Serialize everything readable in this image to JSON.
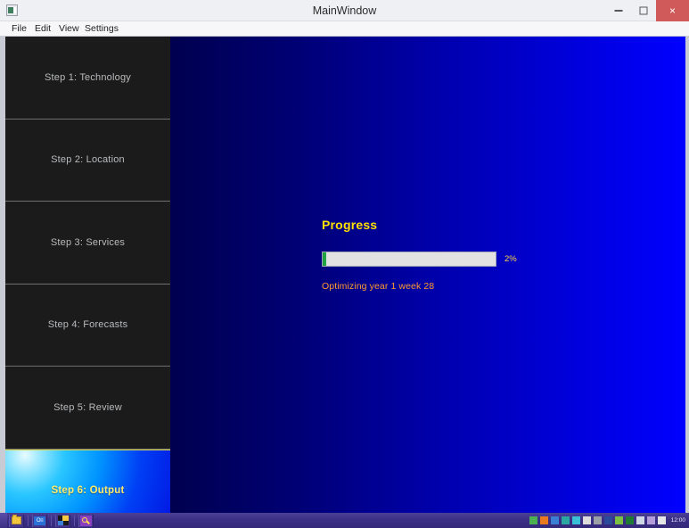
{
  "window": {
    "title": "MainWindow",
    "icon": "app-document-icon",
    "controls": {
      "minimize": "–",
      "maximize": "□",
      "close": "×"
    }
  },
  "menubar": {
    "items": [
      {
        "label": "File"
      },
      {
        "label": "Edit"
      },
      {
        "label": "View"
      },
      {
        "label": "Settings"
      }
    ]
  },
  "sidebar": {
    "steps": [
      {
        "label": "Step 1: Technology",
        "active": false
      },
      {
        "label": "Step 2: Location",
        "active": false
      },
      {
        "label": "Step 3: Services",
        "active": false
      },
      {
        "label": "Step 4: Forecasts",
        "active": false
      },
      {
        "label": "Step 5: Review",
        "active": false
      },
      {
        "label": "Step 6: Output",
        "active": true
      }
    ]
  },
  "main": {
    "progress": {
      "title": "Progress",
      "percent_label": "2%",
      "percent_value": 2,
      "status": "Optimizing year 1 week 28"
    }
  },
  "taskbar": {
    "quick_launch": [
      {
        "name": "folder-icon"
      },
      {
        "name": "outlook-express-icon",
        "text": "O≡"
      },
      {
        "name": "show-desktop-icon"
      },
      {
        "name": "search-icon"
      }
    ],
    "tray_icons": [
      {
        "name": "tray-icon-green",
        "color": "#4caf50"
      },
      {
        "name": "tray-icon-orange",
        "color": "#e8791f"
      },
      {
        "name": "tray-icon-blue",
        "color": "#3b7fd4"
      },
      {
        "name": "tray-icon-teal",
        "color": "#2aa7a0"
      },
      {
        "name": "tray-icon-cyan",
        "color": "#39bfd6"
      },
      {
        "name": "tray-icon-white",
        "color": "#dcdcdc"
      },
      {
        "name": "tray-icon-grey",
        "color": "#9aa0a6"
      },
      {
        "name": "tray-icon-navy",
        "color": "#2c4a9a"
      },
      {
        "name": "tray-icon-lime",
        "color": "#7ac143"
      },
      {
        "name": "tray-icon-darkgreen",
        "color": "#1f7a33"
      },
      {
        "name": "tray-icon-speaker",
        "color": "#cfd6e6"
      },
      {
        "name": "tray-icon-lilac",
        "color": "#b39ddb"
      },
      {
        "name": "tray-icon-label-eng",
        "color": "#e6e6e6"
      }
    ],
    "clock": "12:00"
  },
  "colors": {
    "titlebar_bg": "#eff0f3",
    "close_button": "#d05a5a",
    "sidebar_item_bg": "#1b1b1b",
    "sidebar_text": "#b9bbbe",
    "active_step_text": "#ffe96a",
    "active_step_border": "#d8d84a",
    "main_gradient_start": "#00004f",
    "main_gradient_end": "#0000ff",
    "progress_title": "#ffe000",
    "progress_fill": "#23a847",
    "progress_track": "#e2e2e2",
    "progress_pct_text": "#ffd24a",
    "status_text": "#ff9a2e",
    "taskbar_bg": "#3b2f86"
  }
}
